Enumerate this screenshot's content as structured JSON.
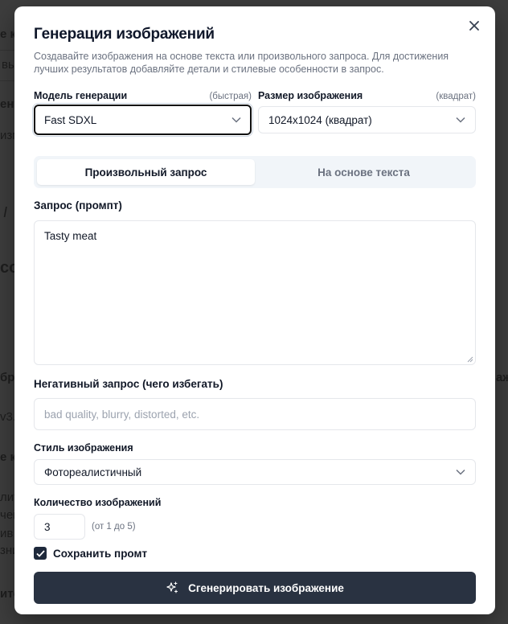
{
  "background_fragments": [
    "е к",
    "вы",
    "ент",
    "изм",
    "I",
    "co",
    "бра",
    "v3.",
    "е к",
    "лит",
    "чей",
    "ив",
    "зни",
    "ите",
    "аж"
  ],
  "modal": {
    "title": "Генерация изображений",
    "subtitle": "Создавайте изображения на основе текста или произвольного запроса. Для достижения лучших результатов добавляйте детали и стилевые особенности в запрос.",
    "close_icon": "close-icon"
  },
  "model": {
    "label": "Модель генерации",
    "hint": "(быстрая)",
    "value": "Fast SDXL"
  },
  "size": {
    "label": "Размер изображения",
    "hint": "(квадрат)",
    "value": "1024x1024 (квадрат)"
  },
  "tabs": [
    {
      "label": "Произвольный запрос",
      "active": true
    },
    {
      "label": "На основе текста",
      "active": false
    }
  ],
  "prompt": {
    "label": "Запрос (промпт)",
    "value": "Tasty meat"
  },
  "negative": {
    "label": "Негативный запрос (чего избегать)",
    "placeholder": "bad quality, blurry, distorted, etc."
  },
  "style": {
    "label": "Стиль изображения",
    "value": "Фотореалистичный"
  },
  "count": {
    "label": "Количество изображений",
    "value": "3",
    "hint": "(от 1 до 5)"
  },
  "save_prompt": {
    "label": "Сохранить промт",
    "checked": true
  },
  "generate": {
    "label": "Сгенерировать изображение",
    "icon": "sparkles-icon"
  },
  "colors": {
    "button_bg": "#293241",
    "overlay": "#3d3d3d"
  }
}
